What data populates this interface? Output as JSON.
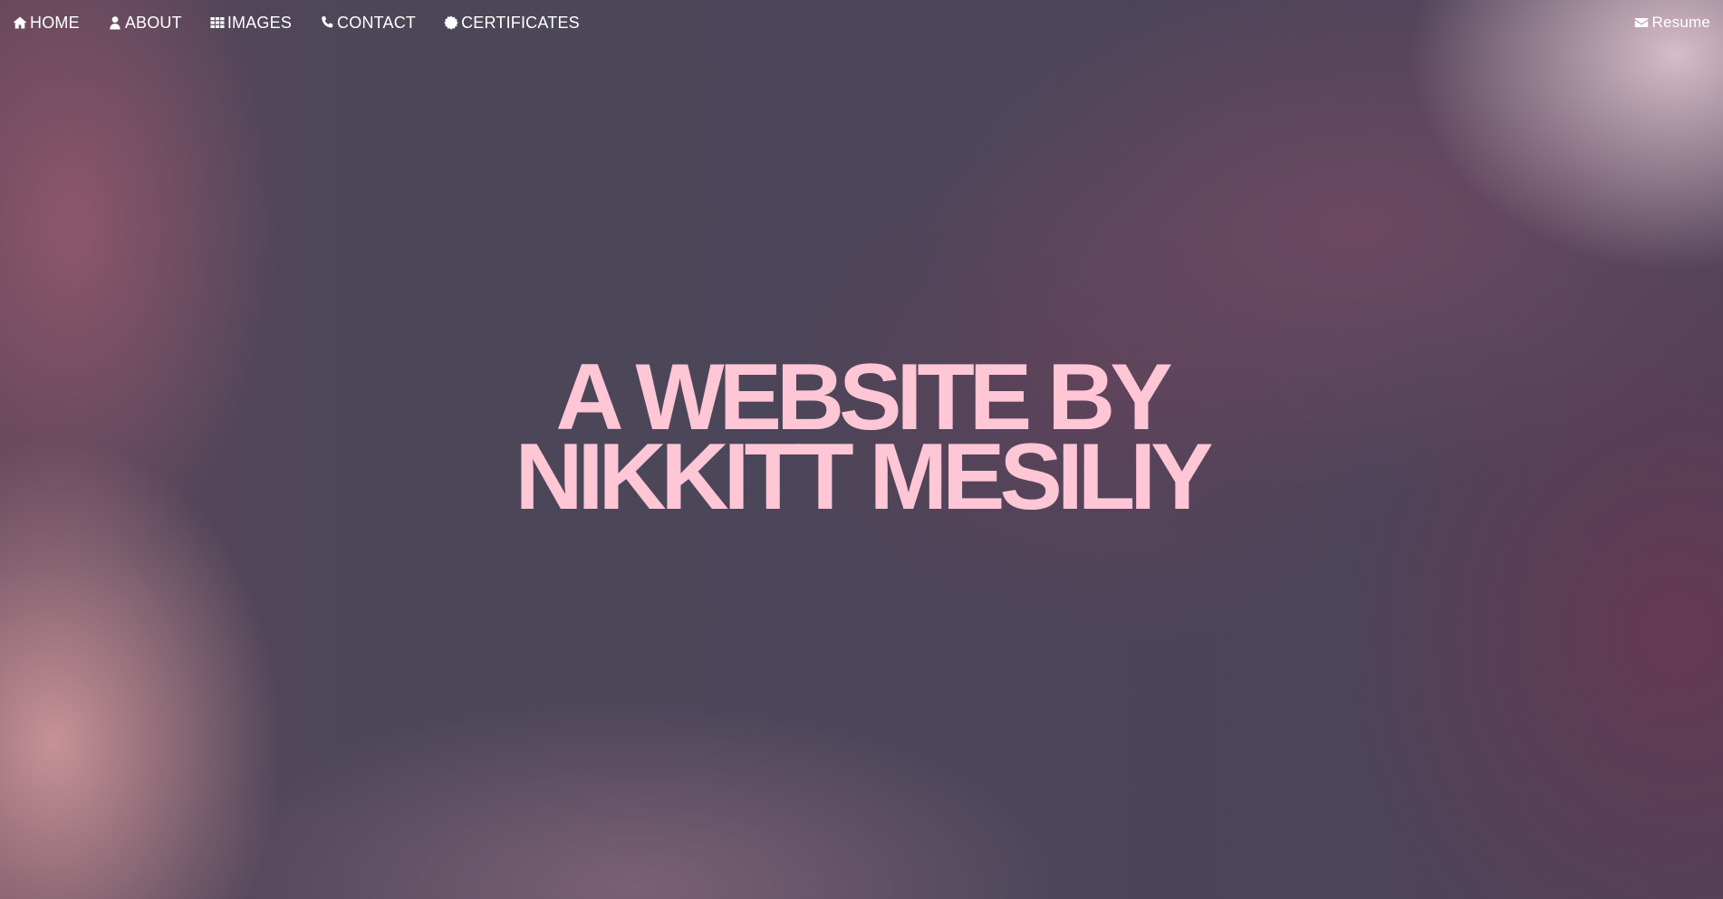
{
  "nav": {
    "items": [
      {
        "label": "HOME",
        "icon": "home-icon"
      },
      {
        "label": "ABOUT",
        "icon": "user-icon"
      },
      {
        "label": "IMAGES",
        "icon": "grid-icon"
      },
      {
        "label": "CONTACT",
        "icon": "phone-icon"
      },
      {
        "label": "CERTIFICATES",
        "icon": "badge-icon"
      }
    ],
    "resume": {
      "label": "Resume",
      "icon": "envelope-icon"
    }
  },
  "hero": {
    "line1": "A WEBSITE BY",
    "line2": "NIKKITT MESILIY"
  },
  "colors": {
    "nav_text": "#ffffff",
    "hero_text": "#ffc6d5",
    "background_base": "#4a4559"
  }
}
